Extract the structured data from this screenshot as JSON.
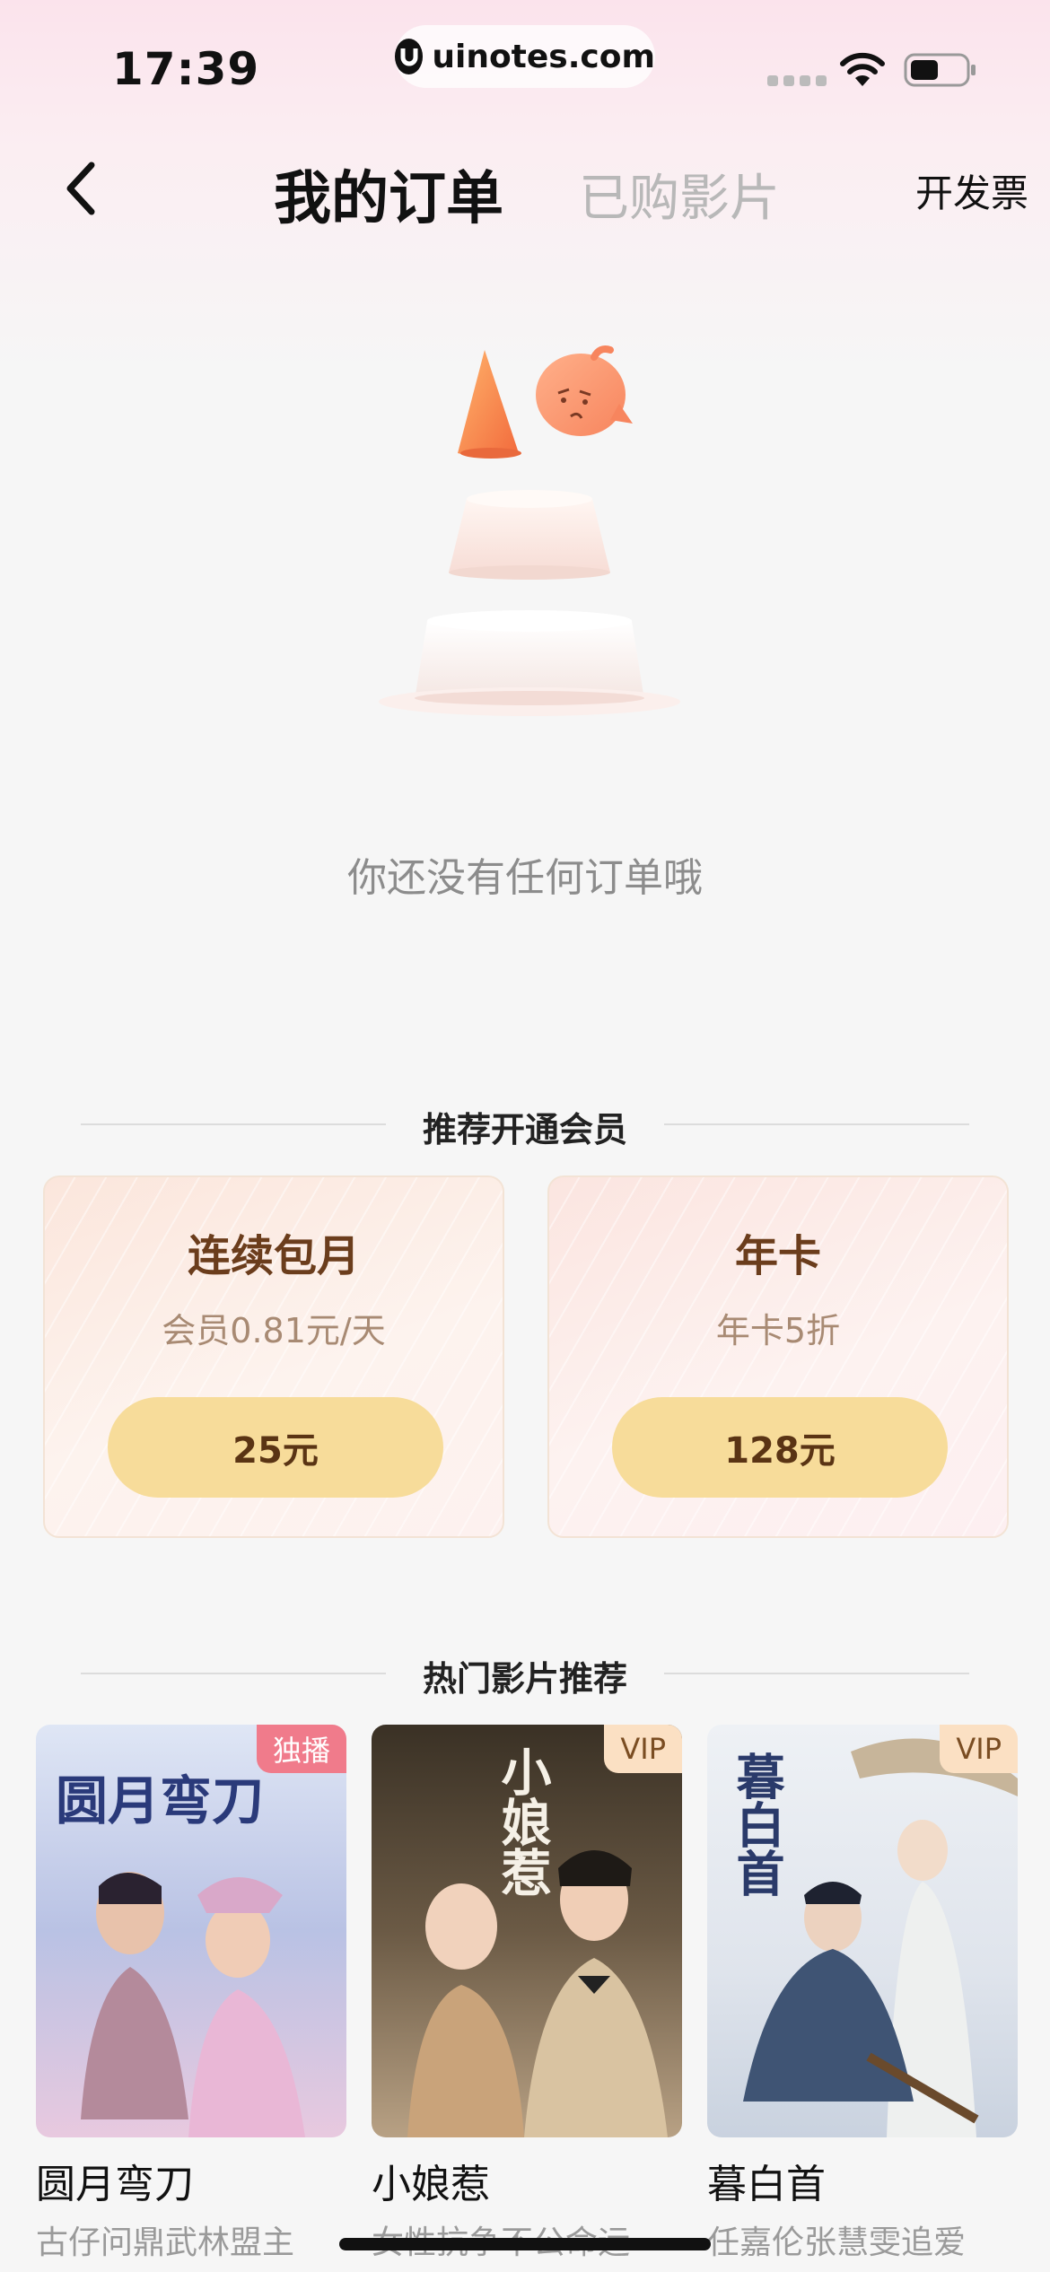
{
  "status_bar": {
    "time": "17:39",
    "url": "uinotes.com"
  },
  "nav": {
    "tab_active": "我的订单",
    "tab_inactive": "已购影片",
    "invoice": "开发票"
  },
  "empty_state": {
    "message": "你还没有任何订单哦"
  },
  "membership": {
    "header": "推荐开通会员",
    "cards": [
      {
        "title": "连续包月",
        "subtitle": "会员0.81元/天",
        "price": "25元"
      },
      {
        "title": "年卡",
        "subtitle": "年卡5折",
        "price": "128元"
      }
    ]
  },
  "movies": {
    "header": "热门影片推荐",
    "items": [
      {
        "name": "圆月弯刀",
        "desc": "古仔问鼎武林盟主",
        "badge": "独播",
        "poster_title": "圆月弯刀"
      },
      {
        "name": "小娘惹",
        "desc": "女性抗争不公命运",
        "badge": "VIP",
        "poster_title": "小娘惹"
      },
      {
        "name": "暮白首",
        "desc": "任嘉伦张慧雯追爱",
        "badge": "VIP",
        "poster_title": "暮白首"
      }
    ]
  },
  "colors": {
    "price_button": "#f7dc9a",
    "card_title": "#6b3d1c",
    "badge_exclusive": "#f07b8b",
    "badge_vip": "#fbe0c3"
  }
}
